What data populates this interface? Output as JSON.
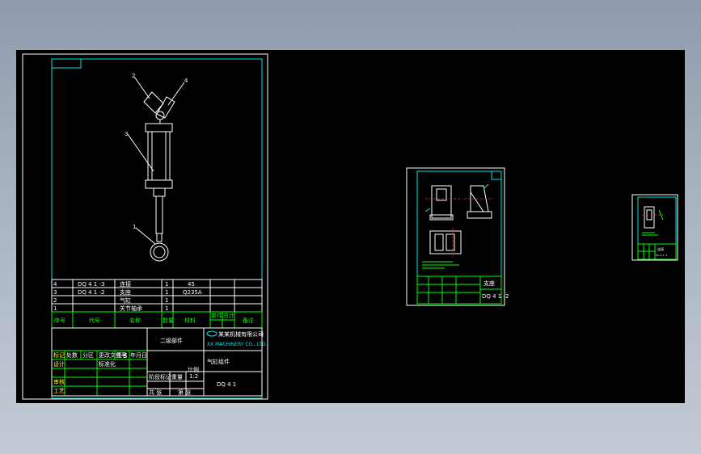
{
  "viewport": {
    "background": "#000000"
  },
  "colors": {
    "frame": "#ffffff",
    "border": "#00e5e5",
    "table": "#00ff00",
    "text": "#ffffff",
    "highlight": "#ffff00"
  },
  "sheet1": {
    "balloons": [
      "2",
      "4",
      "3",
      "1"
    ],
    "bom_rows": [
      {
        "no": "4",
        "code": "DQ 4 1 -3",
        "name": "连接",
        "qty": "1",
        "material": "45",
        "note": ""
      },
      {
        "no": "3",
        "code": "DQ 4 1 -2",
        "name": "支座",
        "qty": "1",
        "material": "Q235A",
        "note": ""
      },
      {
        "no": "2",
        "code": "",
        "name": "气缸",
        "qty": "1",
        "material": "",
        "note": ""
      },
      {
        "no": "1",
        "code": "",
        "name": "关节轴承",
        "qty": "1",
        "material": "",
        "note": ""
      }
    ],
    "bom_header": [
      "序号",
      "代号",
      "名称",
      "数量",
      "材料",
      "单件",
      "总计",
      "备注"
    ],
    "title_block": {
      "drawing_title": "二级部件",
      "company_line1": "某某机械有限公司",
      "company_line2": "XX MACHINERY CO., LTD.",
      "part_name": "气缸组件",
      "drawing_number": "DQ 4 1",
      "scale": "1:2",
      "left_labels": [
        "标记",
        "设计",
        "审核",
        "工艺"
      ],
      "revision_labels": [
        "处数",
        "分区",
        "更改文件号",
        "签名",
        "年月日"
      ],
      "standardization_label": "标准化",
      "stage_labels": [
        "阶段标记",
        "重量",
        "比例"
      ],
      "sheet_labels": [
        "共 张",
        "第 张"
      ]
    }
  },
  "sheet2": {
    "title": "支座",
    "number": "DQ 4 1 -2"
  },
  "sheet3": {
    "title": "连接",
    "number": "DQ 4 1 -3"
  }
}
